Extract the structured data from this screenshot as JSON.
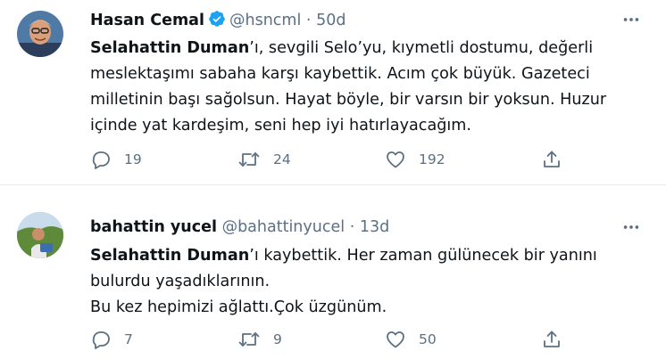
{
  "tweets": [
    {
      "author": {
        "name": "Hasan Cemal",
        "handle": "@hsncml",
        "verified": true
      },
      "separator": "·",
      "time": "50d",
      "text": {
        "bold": "Selahattin Duman",
        "line1": "’ı, sevgili Selo’yu, kıymetli dostumu, değerli",
        "line2": "meslektaşımı sabaha karşı kaybettik. Acım çok büyük. Gazeteci",
        "line3": "milletinin başı sağolsun. Hayat böyle, bir varsın bir yoksun. Huzur",
        "line4": "içinde yat kardeşim, seni hep iyi hatırlayacağım."
      },
      "replies": "19",
      "retweets": "24",
      "likes": "192"
    },
    {
      "author": {
        "name": "bahattin yucel",
        "handle": "@bahattinyucel",
        "verified": false
      },
      "separator": "·",
      "time": "13d",
      "text": {
        "bold": "Selahattin Duman",
        "line1": "’ı kaybettik. Her zaman gülünecek bir yanını",
        "line2": "bulurdu yaşadıklarının.",
        "line3": "Bu kez hepimizi ağlattı.Çok üzgünüm."
      },
      "replies": "7",
      "retweets": "9",
      "likes": "50"
    }
  ],
  "colors": {
    "secondary_text": "#5b7083",
    "verified": "#1da1f2",
    "divider": "#e6ecf0"
  },
  "icons": [
    "verified-badge-icon",
    "more-icon",
    "reply-icon",
    "retweet-icon",
    "like-icon",
    "share-icon"
  ]
}
